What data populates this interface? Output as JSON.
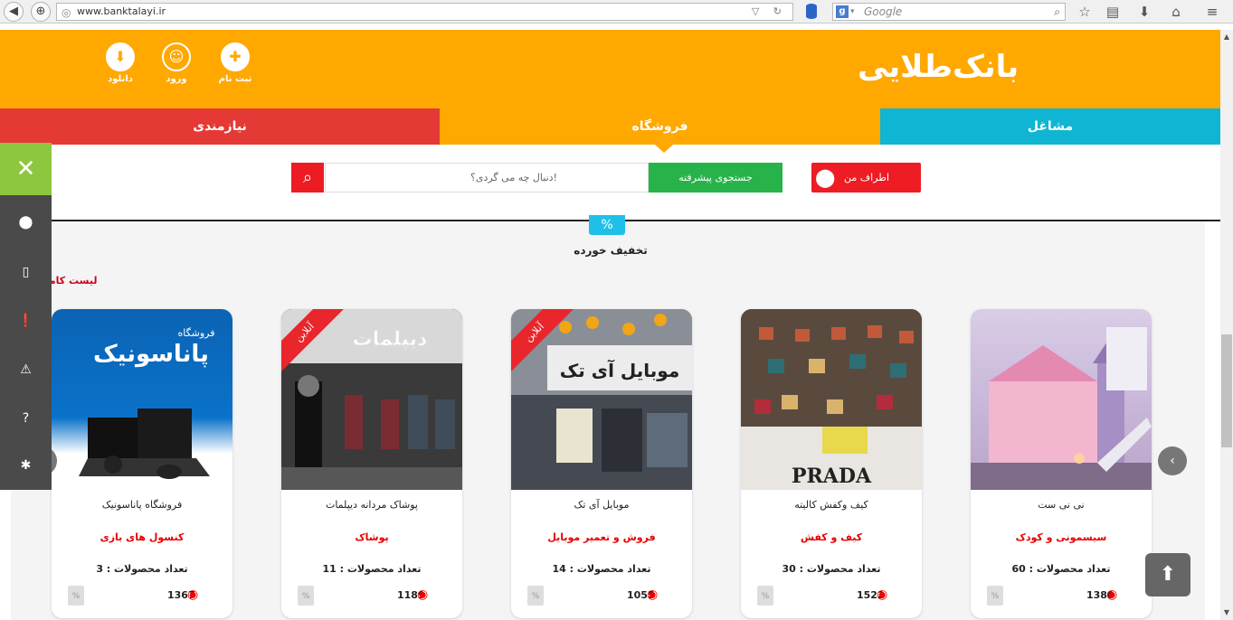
{
  "browser": {
    "url": "www.banktalayi.ir",
    "search_placeholder": "Google"
  },
  "header": {
    "logo": "بانک‌طلایی",
    "download_label": "دانلود",
    "login_label": "ورود",
    "register_label": "ثبت نام"
  },
  "tabs": {
    "needs": "نیازمندی",
    "store": "فروشگاه",
    "jobs": "مشاغل"
  },
  "search": {
    "placeholder": "دنبال چه می گردی؟!",
    "advanced_label": "جستجوی پیشرفته",
    "nearby_label": "اطراف من"
  },
  "section": {
    "badge": "%",
    "title": "تخفیف خورده",
    "full_list": "لیست کامل"
  },
  "cards": [
    {
      "name": "فروشگاه پاناسونیک",
      "category": "کنسول های بازی",
      "count": "تعداد محصولات : 3",
      "views": "1367",
      "ribbon": "",
      "image_text": "پاناسونیک",
      "image_sub": "فروشگاه"
    },
    {
      "name": "پوشاک مردانه دیپلمات",
      "category": "پوشاک",
      "count": "تعداد محصولات : 11",
      "views": "1189",
      "ribbon": "آنلاین",
      "image_text": "دیپلمات",
      "image_sub": ""
    },
    {
      "name": "موبایل آی تک",
      "category": "فروش و تعمیر موبایل",
      "count": "تعداد محصولات : 14",
      "views": "1055",
      "ribbon": "آنلاین",
      "image_text": "موبایل آی تک",
      "image_sub": ""
    },
    {
      "name": "کیف وکفش کالیته",
      "category": "کیف و کفش",
      "count": "تعداد محصولات : 30",
      "views": "1522",
      "ribbon": "",
      "image_text": "PRADA",
      "image_sub": ""
    },
    {
      "name": "نی نی ست",
      "category": "سیسمونی و کودک",
      "count": "تعداد محصولات : 60",
      "views": "1380",
      "ribbon": "",
      "image_text": "",
      "image_sub": ""
    }
  ],
  "colors": {
    "orange": "#ffa800",
    "red": "#e53935",
    "cyan": "#0fb5d3",
    "green": "#27b34a",
    "sidebar_green": "#8dc63f"
  }
}
